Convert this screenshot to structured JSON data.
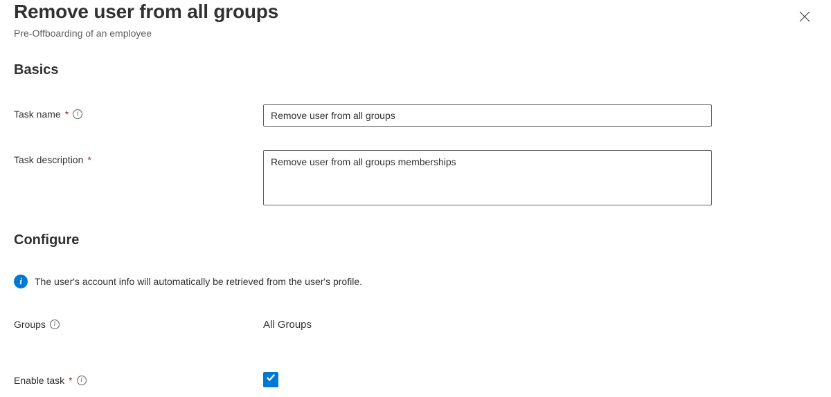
{
  "header": {
    "title": "Remove user from all groups",
    "subtitle": "Pre-Offboarding of an employee"
  },
  "sections": {
    "basics": {
      "title": "Basics",
      "fields": {
        "task_name": {
          "label": "Task name",
          "value": "Remove user from all groups"
        },
        "task_description": {
          "label": "Task description",
          "value": "Remove user from all groups memberships"
        }
      }
    },
    "configure": {
      "title": "Configure",
      "info_message": "The user's account info will automatically be retrieved from the user's profile.",
      "fields": {
        "groups": {
          "label": "Groups",
          "value": "All Groups"
        },
        "enable_task": {
          "label": "Enable task",
          "checked": true
        }
      }
    }
  }
}
